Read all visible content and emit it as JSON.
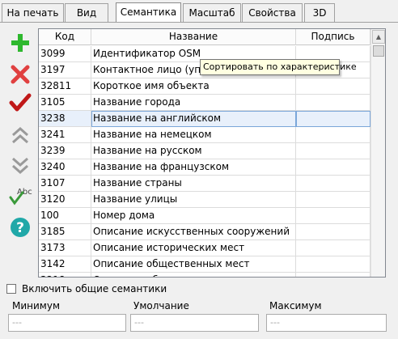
{
  "tabs": [
    {
      "label": "На печать"
    },
    {
      "label": "Вид"
    },
    {
      "label": "Семантика"
    },
    {
      "label": "Масштаб"
    },
    {
      "label": "Свойства"
    },
    {
      "label": "3D"
    }
  ],
  "table": {
    "headers": {
      "code": "Код",
      "name": "Название",
      "sign": "Подпись"
    },
    "rows": [
      {
        "code": "3099",
        "name": "Идентификатор OSM",
        "sign": ""
      },
      {
        "code": "3197",
        "name": "Контактное лицо (управ",
        "sign": ""
      },
      {
        "code": "32811",
        "name": "Короткое имя объекта",
        "sign": ""
      },
      {
        "code": "3105",
        "name": "Название города",
        "sign": ""
      },
      {
        "code": "3238",
        "name": "Название на английском",
        "sign": ""
      },
      {
        "code": "3241",
        "name": "Название на немецком",
        "sign": ""
      },
      {
        "code": "3239",
        "name": "Название на русском",
        "sign": ""
      },
      {
        "code": "3240",
        "name": "Название на французском",
        "sign": ""
      },
      {
        "code": "3107",
        "name": "Название страны",
        "sign": ""
      },
      {
        "code": "3120",
        "name": "Название улицы",
        "sign": ""
      },
      {
        "code": "100",
        "name": "Номер дома",
        "sign": ""
      },
      {
        "code": "3185",
        "name": "Описание искусственных сооружений",
        "sign": ""
      },
      {
        "code": "3173",
        "name": "Описание исторических мест",
        "sign": ""
      },
      {
        "code": "3142",
        "name": "Описание общественных мест",
        "sign": ""
      },
      {
        "code": "3218",
        "name": "Описание объектов туризма",
        "sign": ""
      }
    ]
  },
  "tooltip": "Сортировать по характеристике",
  "toolbar": {
    "add": "plus-icon",
    "delete": "cross-icon",
    "apply": "checkmark-icon",
    "up": "double-chevron-up-icon",
    "down": "double-chevron-down-icon",
    "spell": "abc-check-icon",
    "help": "question-icon"
  },
  "include_common": {
    "label": "Включить общие семантики",
    "checked": false
  },
  "fields": {
    "min": {
      "label": "Минимум",
      "value": "---"
    },
    "default": {
      "label": "Умолчание",
      "value": "---"
    },
    "max": {
      "label": "Максимум",
      "value": "---"
    }
  },
  "colors": {
    "add": "#2eb82e",
    "delete": "#e04040",
    "apply": "#c01818",
    "arrows": "#9a9a9a",
    "help": "#20a8a8",
    "selection": "#e8f0fb"
  }
}
